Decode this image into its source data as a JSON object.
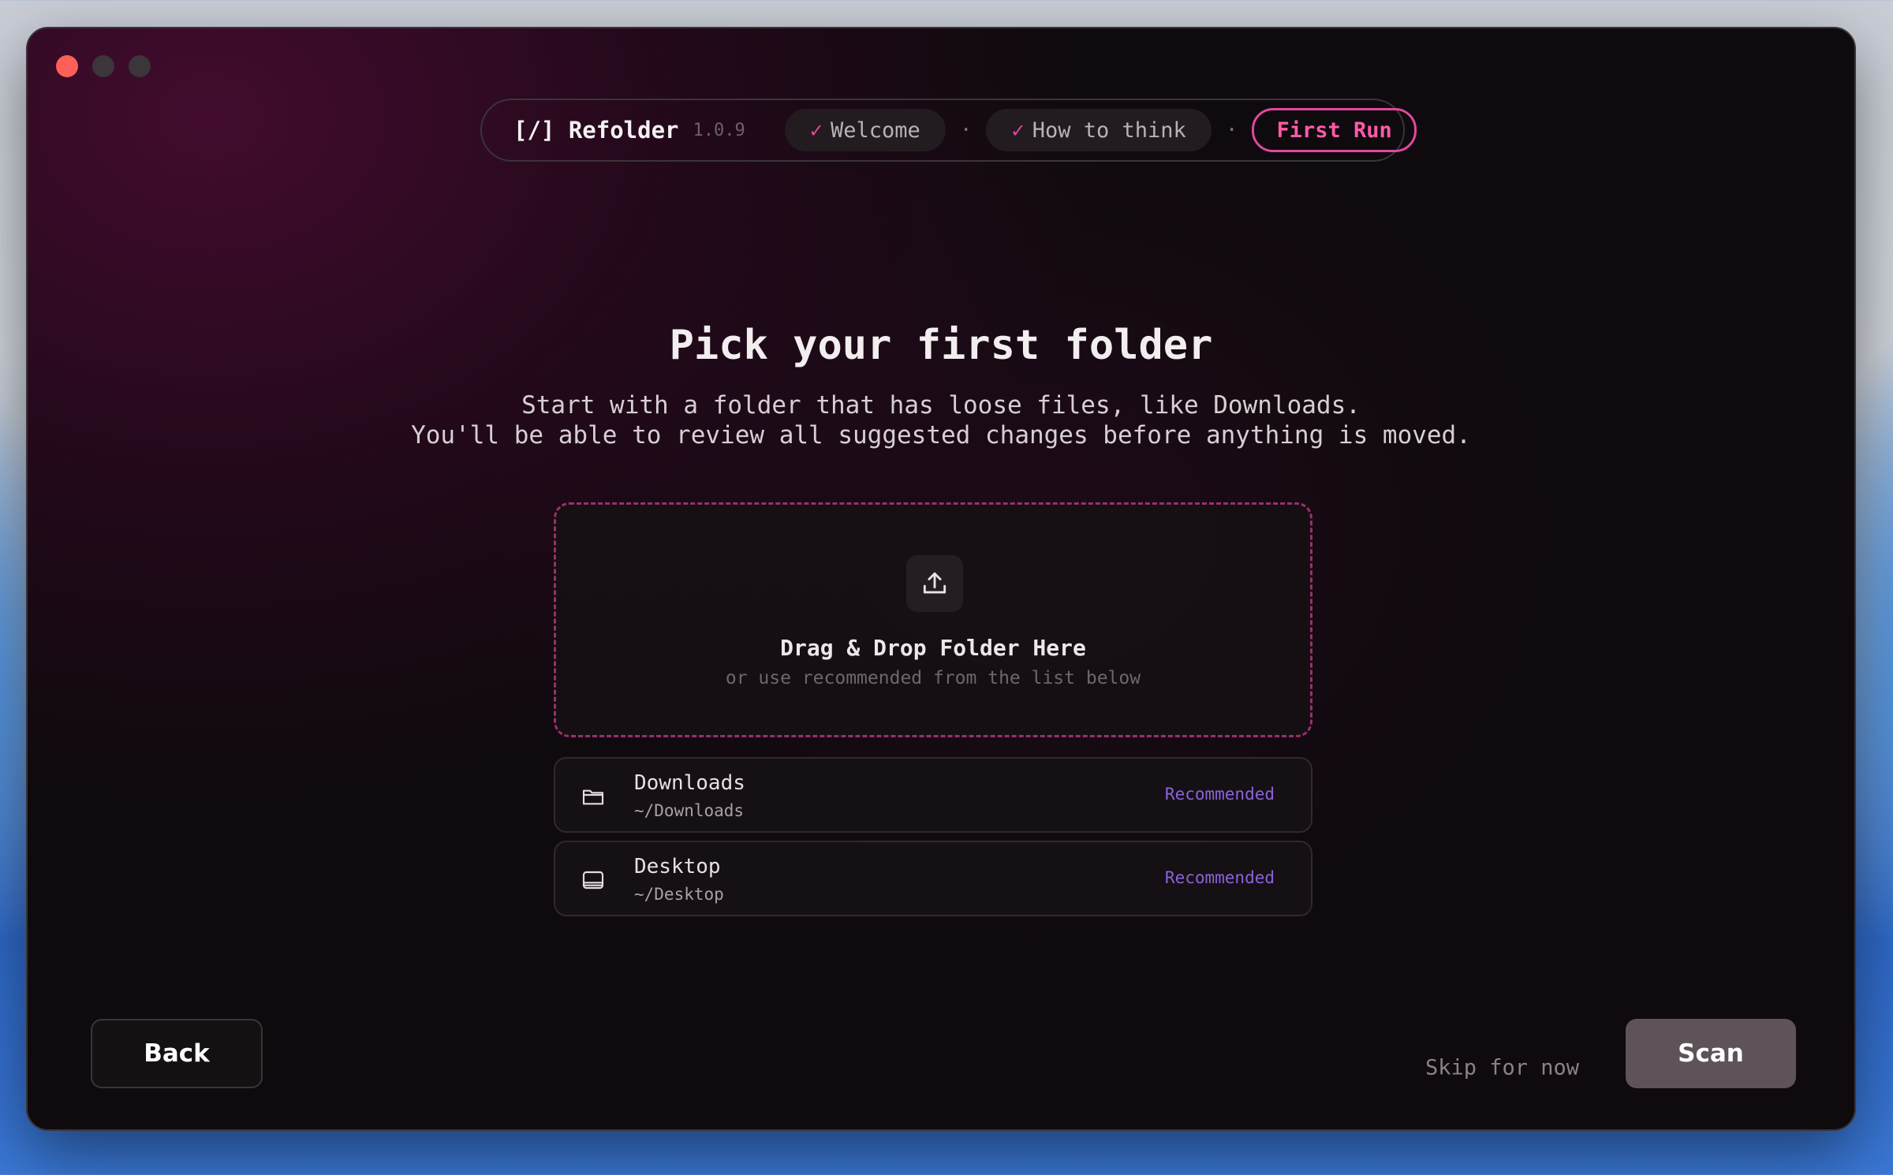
{
  "app": {
    "brand": "[/] Refolder",
    "version": "1.0.9"
  },
  "steps": [
    {
      "label": "Welcome",
      "check": "✓",
      "state": "done"
    },
    {
      "label": "How to think",
      "check": "✓",
      "state": "done"
    },
    {
      "label": "First Run",
      "state": "active"
    }
  ],
  "step_separator": "·",
  "main": {
    "title": "Pick your first folder",
    "subtitle_line1": "Start with a folder that has loose files, like Downloads.",
    "subtitle_line2": "You'll be able to review all suggested changes before anything is moved."
  },
  "dropzone": {
    "icon": "upload-icon",
    "title": "Drag & Drop Folder Here",
    "subtitle": "or use recommended from the list below"
  },
  "folders": [
    {
      "name": "Downloads",
      "path": "~/Downloads",
      "badge": "Recommended",
      "icon": "folder-icon"
    },
    {
      "name": "Desktop",
      "path": "~/Desktop",
      "badge": "Recommended",
      "icon": "desktop-icon"
    }
  ],
  "footer": {
    "back_label": "Back",
    "skip_label": "Skip for now",
    "scan_label": "Scan"
  },
  "colors": {
    "accent": "#e0489c",
    "badge": "#8b63d8",
    "close": "#fe5f57"
  }
}
